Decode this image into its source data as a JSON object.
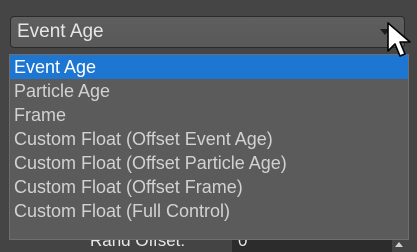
{
  "combo": {
    "selected_value": "Event Age"
  },
  "dropdown": {
    "options": [
      "Event Age",
      "Particle Age",
      "Frame",
      "Custom Float (Offset Event Age)",
      "Custom Float (Offset Particle Age)",
      "Custom Float (Offset Frame)",
      "Custom Float (Full Control)"
    ],
    "selected_index": 0
  },
  "behind": {
    "label": "Rand Offset:",
    "value": "0"
  },
  "colors": {
    "selection": "#1e76d3",
    "background": "#454545",
    "list_background": "#5b5b5b"
  }
}
